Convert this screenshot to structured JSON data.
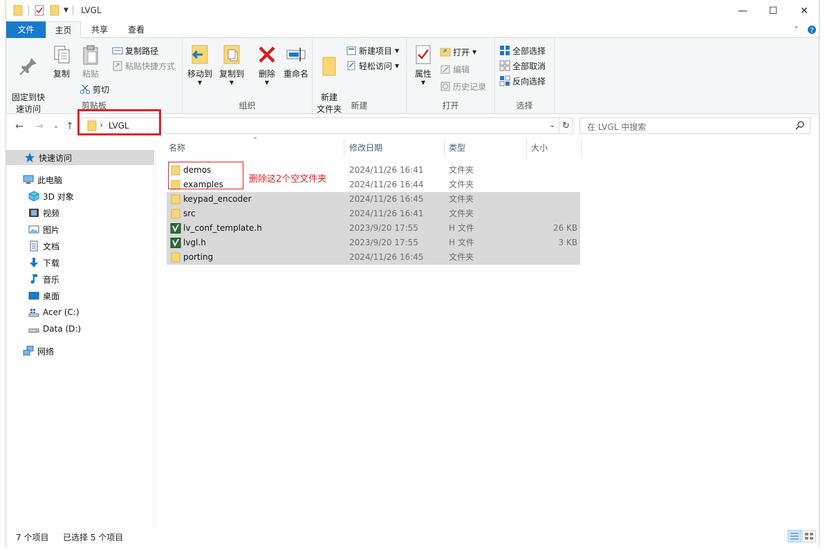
{
  "window": {
    "title": "LVGL"
  },
  "ribbon_tabs": [
    "文件",
    "主页",
    "共享",
    "查看"
  ],
  "clipboard": {
    "pin": "固定到快\n速访问",
    "copy": "复制",
    "paste": "粘贴",
    "copy_path": "复制路径",
    "paste_shortcut": "粘贴快捷方式",
    "cut": "剪切",
    "label": "剪贴板"
  },
  "organize": {
    "move_to": "移动到",
    "copy_to": "复制到",
    "delete": "删除",
    "rename": "重命名",
    "label": "组织"
  },
  "new_group": {
    "new_folder": "新建\n文件夹",
    "new_item": "新建项目",
    "easy_access": "轻松访问",
    "label": "新建"
  },
  "open_group": {
    "properties": "属性",
    "open": "打开",
    "edit": "编辑",
    "history": "历史记录",
    "label": "打开"
  },
  "select_group": {
    "select_all": "全部选择",
    "select_none": "全部取消",
    "invert": "反向选择",
    "label": "选择"
  },
  "address": {
    "path": "LVGL",
    "search_placeholder": "在 LVGL 中搜索"
  },
  "nav_pane": {
    "quick_access": "快速访问",
    "this_pc": "此电脑",
    "objects_3d": "3D 对象",
    "videos": "视频",
    "pictures": "图片",
    "documents": "文档",
    "downloads": "下载",
    "music": "音乐",
    "desktop": "桌面",
    "drive_c": "Acer (C:)",
    "drive_d": "Data (D:)",
    "network": "网络"
  },
  "columns": {
    "name": "名称",
    "date": "修改日期",
    "type": "类型",
    "size": "大小"
  },
  "files": [
    {
      "name": "demos",
      "date": "2024/11/26 16:41",
      "type": "文件夹",
      "size": "",
      "kind": "folder",
      "selected": false
    },
    {
      "name": "examples",
      "date": "2024/11/26 16:44",
      "type": "文件夹",
      "size": "",
      "kind": "folder",
      "selected": false
    },
    {
      "name": "keypad_encoder",
      "date": "2024/11/26 16:45",
      "type": "文件夹",
      "size": "",
      "kind": "folder",
      "selected": true
    },
    {
      "name": "src",
      "date": "2024/11/26 16:41",
      "type": "文件夹",
      "size": "",
      "kind": "folder",
      "selected": true
    },
    {
      "name": "lv_conf_template.h",
      "date": "2023/9/20 17:55",
      "type": "H 文件",
      "size": "26 KB",
      "kind": "h",
      "selected": true
    },
    {
      "name": "lvgl.h",
      "date": "2023/9/20 17:55",
      "type": "H 文件",
      "size": "3 KB",
      "kind": "h",
      "selected": true
    },
    {
      "name": "porting",
      "date": "2024/11/26 16:45",
      "type": "文件夹",
      "size": "",
      "kind": "folder",
      "selected": true
    }
  ],
  "annotation": "删除这2个空文件夹",
  "status": {
    "count": "7 个项目",
    "selected": "已选择 5 个项目"
  },
  "colors": {
    "accent": "#1979ca",
    "annotation": "#e0202a",
    "selection": "#d9d9d9",
    "folder": "#f8d775"
  }
}
